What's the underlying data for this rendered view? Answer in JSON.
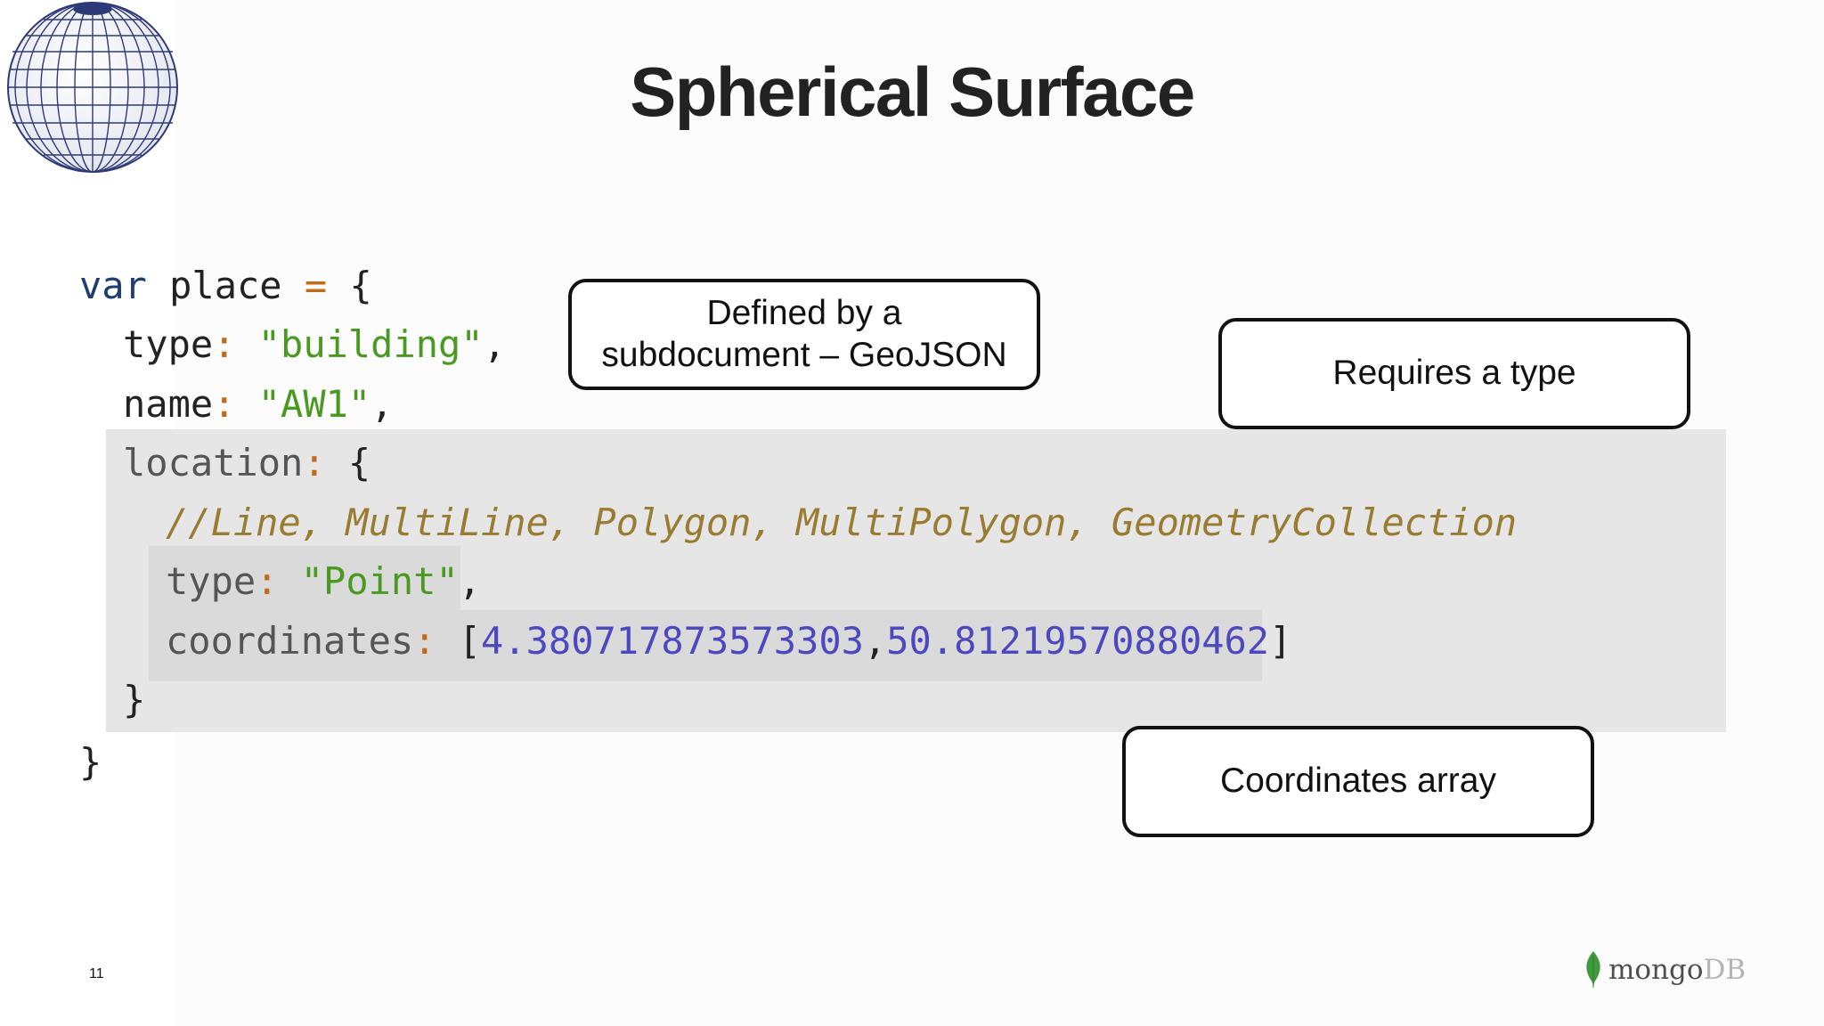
{
  "slide": {
    "title": "Spherical Surface",
    "page_number": "11"
  },
  "code": {
    "line1": {
      "kw": "var",
      "ident": " place ",
      "op": "=",
      "brace": " {"
    },
    "line2": {
      "key": "type",
      "colon": ":",
      "value": "\"building\"",
      "comma": ","
    },
    "line3": {
      "key": "name",
      "colon": ":",
      "value": "\"AW1\"",
      "comma": ","
    },
    "line4": {
      "key": "location",
      "colon": ":",
      "brace": " {"
    },
    "line5": {
      "comment": "//Line, MultiLine, Polygon, MultiPolygon, GeometryCollection"
    },
    "line6": {
      "key": "type",
      "colon": ":",
      "value": "\"Point\"",
      "comma": ","
    },
    "line7": {
      "key": "coordinates",
      "colon": ":",
      "open": "[",
      "lng": "4.380717873573303",
      "sep": ",",
      "lat": "50.81219570880462",
      "close": "]"
    },
    "line8": {
      "brace": "}"
    },
    "line9": {
      "brace": "}"
    }
  },
  "callouts": {
    "subdocument": {
      "line1": "Defined by a",
      "line2": "subdocument – GeoJSON"
    },
    "type": "Requires a type",
    "coordinates": "Coordinates array"
  },
  "logo": {
    "part1": "mongo",
    "part2": "DB"
  },
  "colors": {
    "keyword": "#1d3d73",
    "operator": "#c26a17",
    "string": "#4a9a21",
    "number": "#4b48c0",
    "comment": "#9a7b32",
    "leaf": "#3f9a3b"
  }
}
